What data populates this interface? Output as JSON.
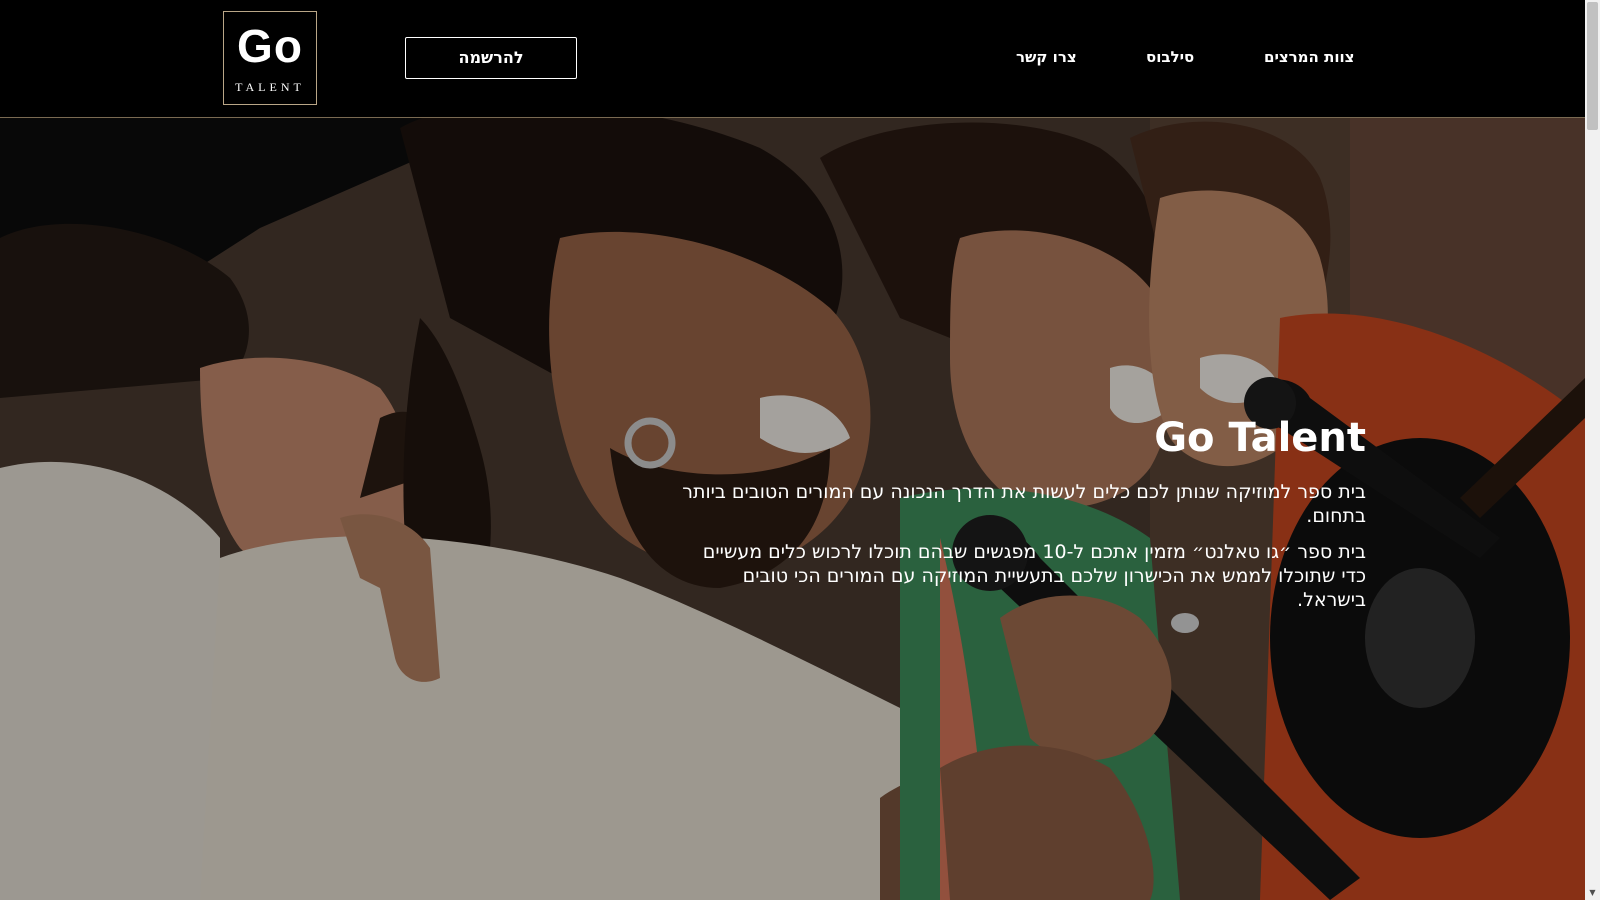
{
  "header": {
    "logo": {
      "main": "Go",
      "sub": "TALENT"
    },
    "register_label": "להרשמה",
    "nav": [
      {
        "id": "team",
        "label": "צוות המרצים"
      },
      {
        "id": "syllabus",
        "label": "סילבוס"
      },
      {
        "id": "contact",
        "label": "צרו קשר"
      }
    ]
  },
  "hero": {
    "title": "Go Talent",
    "paragraph1": "בית ספר למוזיקה שנותן לכם כלים לעשות את הדרך הנכונה עם המורים הטובים ביותר בתחום.",
    "paragraph2": "בית ספר ״גו טאלנט״ מזמין אתכם ל-10 מפגשים שבהם תוכלו לרכוש כלים מעשיים כדי שתוכלו לממש את הכישרון שלכם בתעשיית המוזיקה עם המורים הכי טובים בישראל.",
    "image_icon": "singers-photo"
  },
  "colors": {
    "header_bg": "#000000",
    "logo_border": "#b9a687",
    "text": "#ffffff"
  }
}
